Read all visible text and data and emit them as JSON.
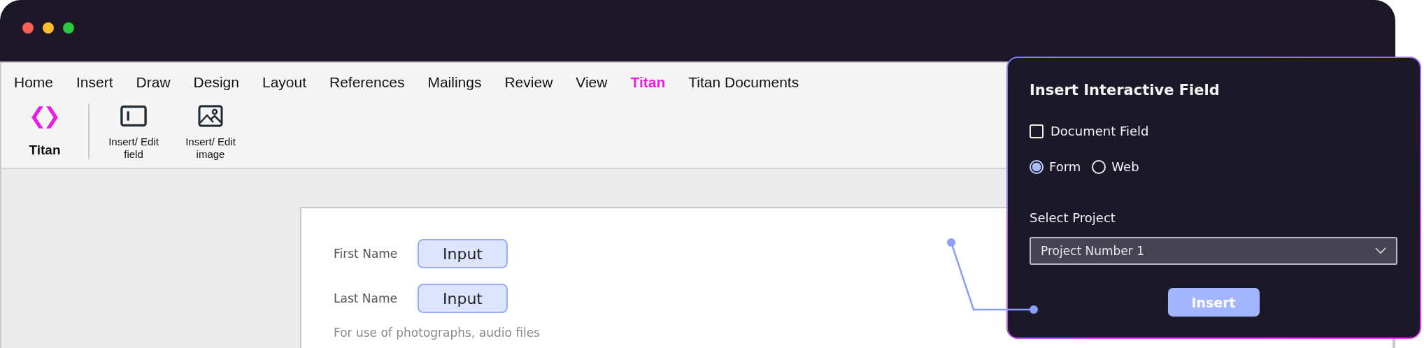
{
  "window": {
    "controls": [
      {
        "color": "#fe5f57"
      },
      {
        "color": "#febc2e"
      },
      {
        "color": "#28c840"
      }
    ]
  },
  "ribbon": {
    "tabs": [
      {
        "label": "Home",
        "selected": false
      },
      {
        "label": "Insert",
        "selected": false
      },
      {
        "label": "Draw",
        "selected": false
      },
      {
        "label": "Design",
        "selected": false
      },
      {
        "label": "Layout",
        "selected": false
      },
      {
        "label": "References",
        "selected": false
      },
      {
        "label": "Mailings",
        "selected": false
      },
      {
        "label": "Review",
        "selected": false
      },
      {
        "label": "View",
        "selected": false
      },
      {
        "label": "Titan",
        "selected": true
      },
      {
        "label": "Titan Documents",
        "selected": false
      }
    ],
    "logo": {
      "label": "Titan"
    },
    "buttons": [
      {
        "kind": "field",
        "label": "Insert/ Edit field"
      },
      {
        "kind": "image",
        "label": "Insert/ Edit image"
      }
    ]
  },
  "document": {
    "fields": [
      {
        "label": "First Name",
        "value": "Input"
      },
      {
        "label": "Last Name",
        "value": "Input"
      }
    ],
    "note": "For use of photographs, audio files"
  },
  "panel": {
    "title": "Insert Interactive Field",
    "checkbox": {
      "label": "Document Field",
      "checked": false
    },
    "radios": [
      {
        "label": "Form",
        "selected": true
      },
      {
        "label": "Web",
        "selected": false
      }
    ],
    "select": {
      "label": "Select Project",
      "value": "Project Number 1"
    },
    "button": "Insert"
  }
}
